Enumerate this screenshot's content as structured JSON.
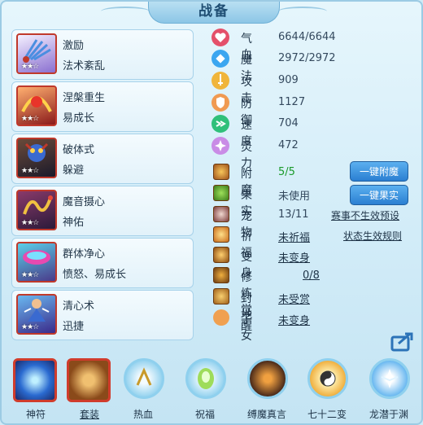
{
  "title": "战备",
  "skills": [
    {
      "name": "激励",
      "sub": "法术紊乱",
      "stars": "★★☆",
      "icon": "fan-icon"
    },
    {
      "name": "涅槃重生",
      "sub": "易成长",
      "stars": "★★☆",
      "icon": "phoenix-icon"
    },
    {
      "name": "破体式",
      "sub": "躲避",
      "stars": "★★☆",
      "icon": "demon-icon"
    },
    {
      "name": "魔音摄心",
      "sub": "神佑",
      "stars": "★★☆",
      "icon": "serpent-icon"
    },
    {
      "name": "群体净心",
      "sub": "愤怒、易成长",
      "stars": "★★☆",
      "icon": "drum-icon"
    },
    {
      "name": "清心术",
      "sub": "迅捷",
      "stars": "★★☆",
      "icon": "monk-icon"
    }
  ],
  "stats": [
    {
      "label": "气血",
      "value": "6644/6644",
      "icon": "heart-icon",
      "color": "#e4506a"
    },
    {
      "label": "魔法",
      "value": "2972/2972",
      "icon": "mana-icon",
      "color": "#3ba6f0"
    },
    {
      "label": "攻击",
      "value": "909",
      "icon": "attack-icon",
      "color": "#f0b53b"
    },
    {
      "label": "防御",
      "value": "1127",
      "icon": "shield-icon",
      "color": "#f09a52"
    },
    {
      "label": "速度",
      "value": "704",
      "icon": "speed-icon",
      "color": "#2fc07a"
    },
    {
      "label": "灵力",
      "value": "472",
      "icon": "spirit-icon",
      "color": "#c98ce6"
    }
  ],
  "extras": [
    {
      "label": "附魔",
      "value": "5/5",
      "icon": "enchant-icon"
    },
    {
      "label": "果实",
      "value": "未使用",
      "icon": "fruit-icon"
    },
    {
      "label": "宠物",
      "value": "13/11",
      "icon": "pet-icon"
    },
    {
      "label": "祈福",
      "value": "未祈福",
      "icon": "blessing-icon"
    },
    {
      "label": "变身",
      "value": "未变身",
      "icon": "transform-icon"
    },
    {
      "label": "修炼觉醒",
      "value": "0/8",
      "icon": "cultivation-icon"
    },
    {
      "label": "封地",
      "value": "未受赏",
      "icon": "fief-icon"
    },
    {
      "label": "子女",
      "value": "未变身",
      "icon": "child-icon"
    }
  ],
  "buttons": {
    "enchant": "一键附魔",
    "fruit": "一键果实"
  },
  "links": {
    "preset": "赛事不生效预设",
    "rules": "状态生效规则"
  },
  "bottom": [
    {
      "label": "神符",
      "icon": "rune-icon",
      "shape": "square"
    },
    {
      "label": "套装",
      "icon": "suit-icon",
      "shape": "square"
    },
    {
      "label": "热血",
      "icon": "hotblood-icon",
      "shape": "circle"
    },
    {
      "label": "祝福",
      "icon": "bless-icon",
      "shape": "circle"
    },
    {
      "label": "缚魔真言",
      "icon": "bind-demon-icon",
      "shape": "circle"
    },
    {
      "label": "七十二变",
      "icon": "seventy-two-icon",
      "shape": "circle"
    },
    {
      "label": "龙潜于渊",
      "icon": "dragon-icon",
      "shape": "circle"
    }
  ]
}
